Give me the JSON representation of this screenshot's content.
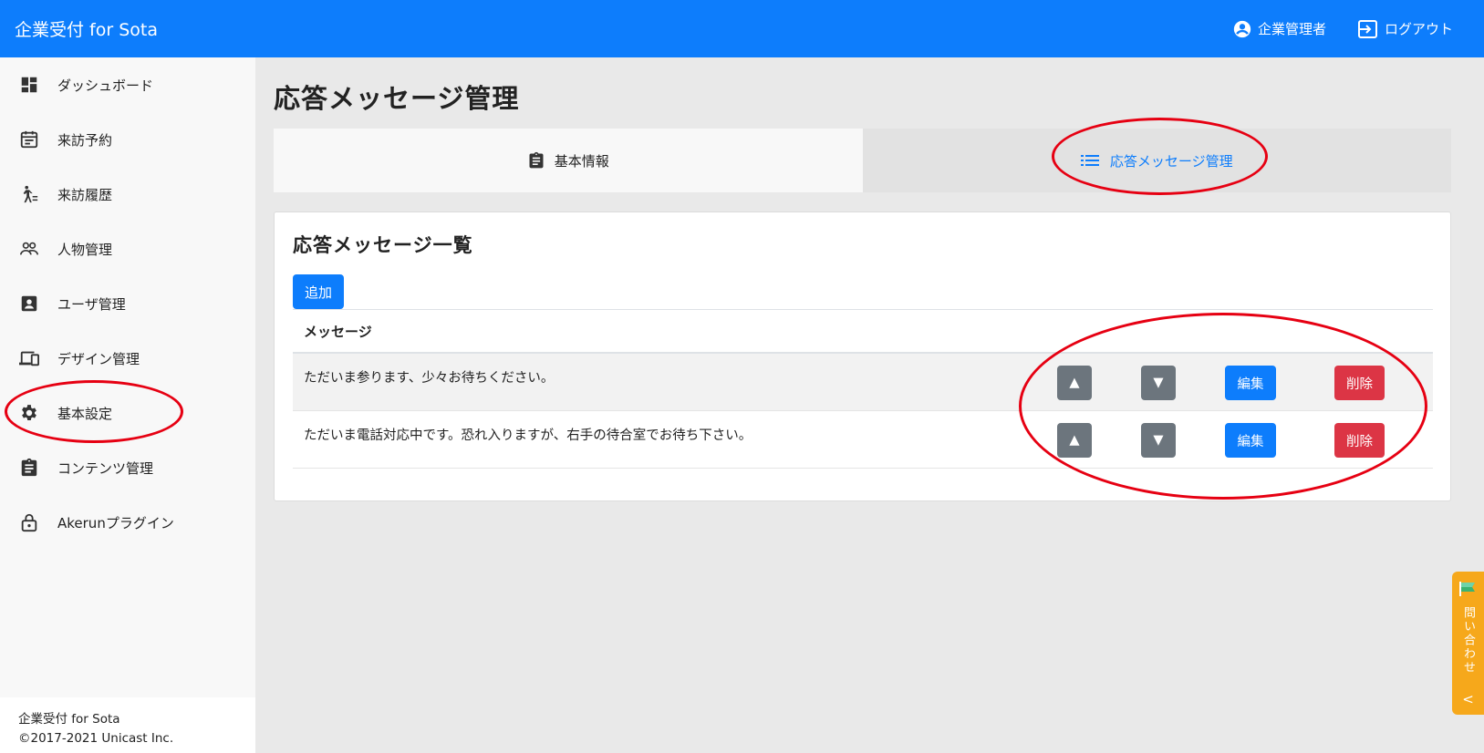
{
  "app": {
    "brand": "企業受付 for Sota",
    "user_label": "企業管理者",
    "logout_label": "ログアウト"
  },
  "sidebar": {
    "items": [
      {
        "label": "ダッシュボード",
        "icon": "dashboard-icon"
      },
      {
        "label": "来訪予約",
        "icon": "calendar-icon"
      },
      {
        "label": "来訪履歴",
        "icon": "walking-person-icon"
      },
      {
        "label": "人物管理",
        "icon": "people-icon"
      },
      {
        "label": "ユーザ管理",
        "icon": "contact-card-icon"
      },
      {
        "label": "デザイン管理",
        "icon": "devices-icon"
      },
      {
        "label": "基本設定",
        "icon": "gear-icon"
      },
      {
        "label": "コンテンツ管理",
        "icon": "clipboard-icon"
      },
      {
        "label": "Akerunプラグイン",
        "icon": "lock-icon"
      }
    ],
    "footer_line1": "企業受付 for Sota",
    "footer_line2": "©2017-2021 Unicast Inc."
  },
  "page": {
    "title": "応答メッセージ管理",
    "tabs": [
      {
        "label": "基本情報",
        "icon": "clipboard-icon"
      },
      {
        "label": "応答メッセージ管理",
        "icon": "list-icon",
        "active": true
      }
    ]
  },
  "card": {
    "title": "応答メッセージ一覧",
    "add_label": "追加",
    "column_header": "メッセージ",
    "rows": [
      {
        "message": "ただいま参ります、少々お待ちください。"
      },
      {
        "message": "ただいま電話対応中です。恐れ入りますが、右手の待合室でお待ち下さい。"
      }
    ],
    "up_label": "▲",
    "down_label": "▼",
    "edit_label": "編集",
    "delete_label": "削除"
  },
  "inquiry": {
    "label": "問い合わせ",
    "chevron": "<"
  },
  "colors": {
    "primary": "#0d7dfc",
    "secondary": "#6c757d",
    "danger": "#dc3545",
    "annotation": "#e60012",
    "inquiry": "#f6a81b"
  }
}
